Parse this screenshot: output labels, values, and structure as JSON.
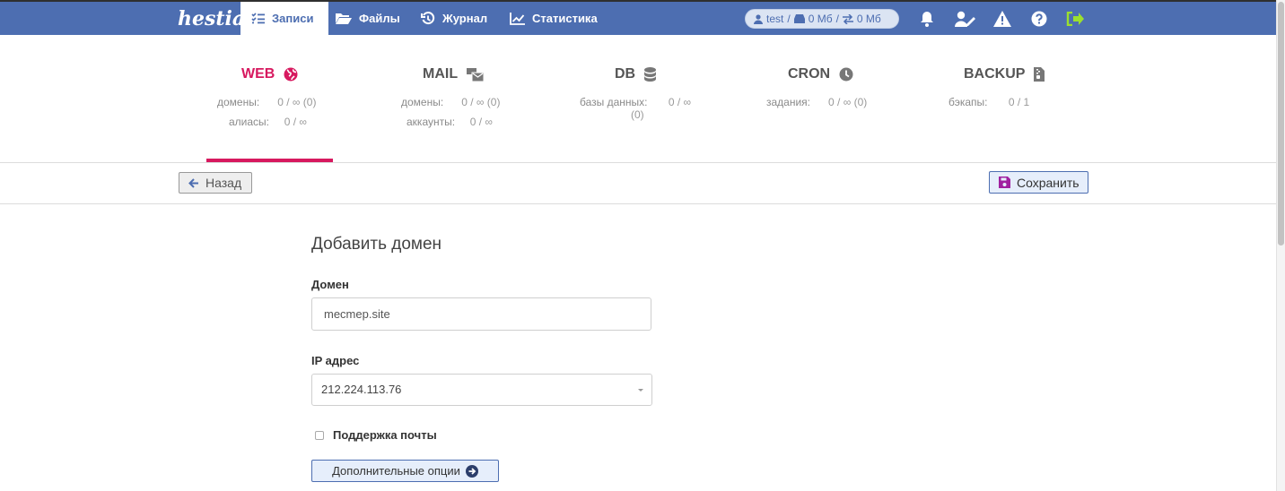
{
  "app": {
    "logo": "hestia"
  },
  "nav": {
    "items": [
      {
        "label": "Записи",
        "icon": "list-check-icon",
        "active": true
      },
      {
        "label": "Файлы",
        "icon": "folder-open-icon",
        "active": false
      },
      {
        "label": "Журнал",
        "icon": "history-icon",
        "active": false
      },
      {
        "label": "Статистика",
        "icon": "chart-line-icon",
        "active": false
      }
    ]
  },
  "user": {
    "name": "test",
    "disk": "0 Мб",
    "bandwidth": "0 Мб"
  },
  "stats": {
    "web": {
      "title": "WEB",
      "row1_label": "домены:",
      "row1_value": "0 / ∞ (0)",
      "row2_label": "алиасы:",
      "row2_value": "0 / ∞"
    },
    "mail": {
      "title": "MAIL",
      "row1_label": "домены:",
      "row1_value": "0 / ∞ (0)",
      "row2_label": "аккаунты:",
      "row2_value": "0 / ∞"
    },
    "db": {
      "title": "DB",
      "row1_label": "базы данных:",
      "row1_value": "0 / ∞",
      "row1_extra": "(0)"
    },
    "cron": {
      "title": "CRON",
      "row1_label": "задания:",
      "row1_value": "0 / ∞ (0)"
    },
    "backup": {
      "title": "BACKUP",
      "row1_label": "бэкапы:",
      "row1_value": "0 / 1"
    }
  },
  "toolbar": {
    "back_label": "Назад",
    "save_label": "Сохранить"
  },
  "form": {
    "title": "Добавить домен",
    "domain_label": "Домен",
    "domain_value": "mecmep.site",
    "ip_label": "IP адрес",
    "ip_value": "212.224.113.76",
    "mail_support_label": "Поддержка почты",
    "mail_support_checked": false,
    "advanced_label": "Дополнительные опции"
  },
  "colors": {
    "topbar": "#4d6eb1",
    "accent": "#d7195f",
    "logout": "#9be02e"
  }
}
